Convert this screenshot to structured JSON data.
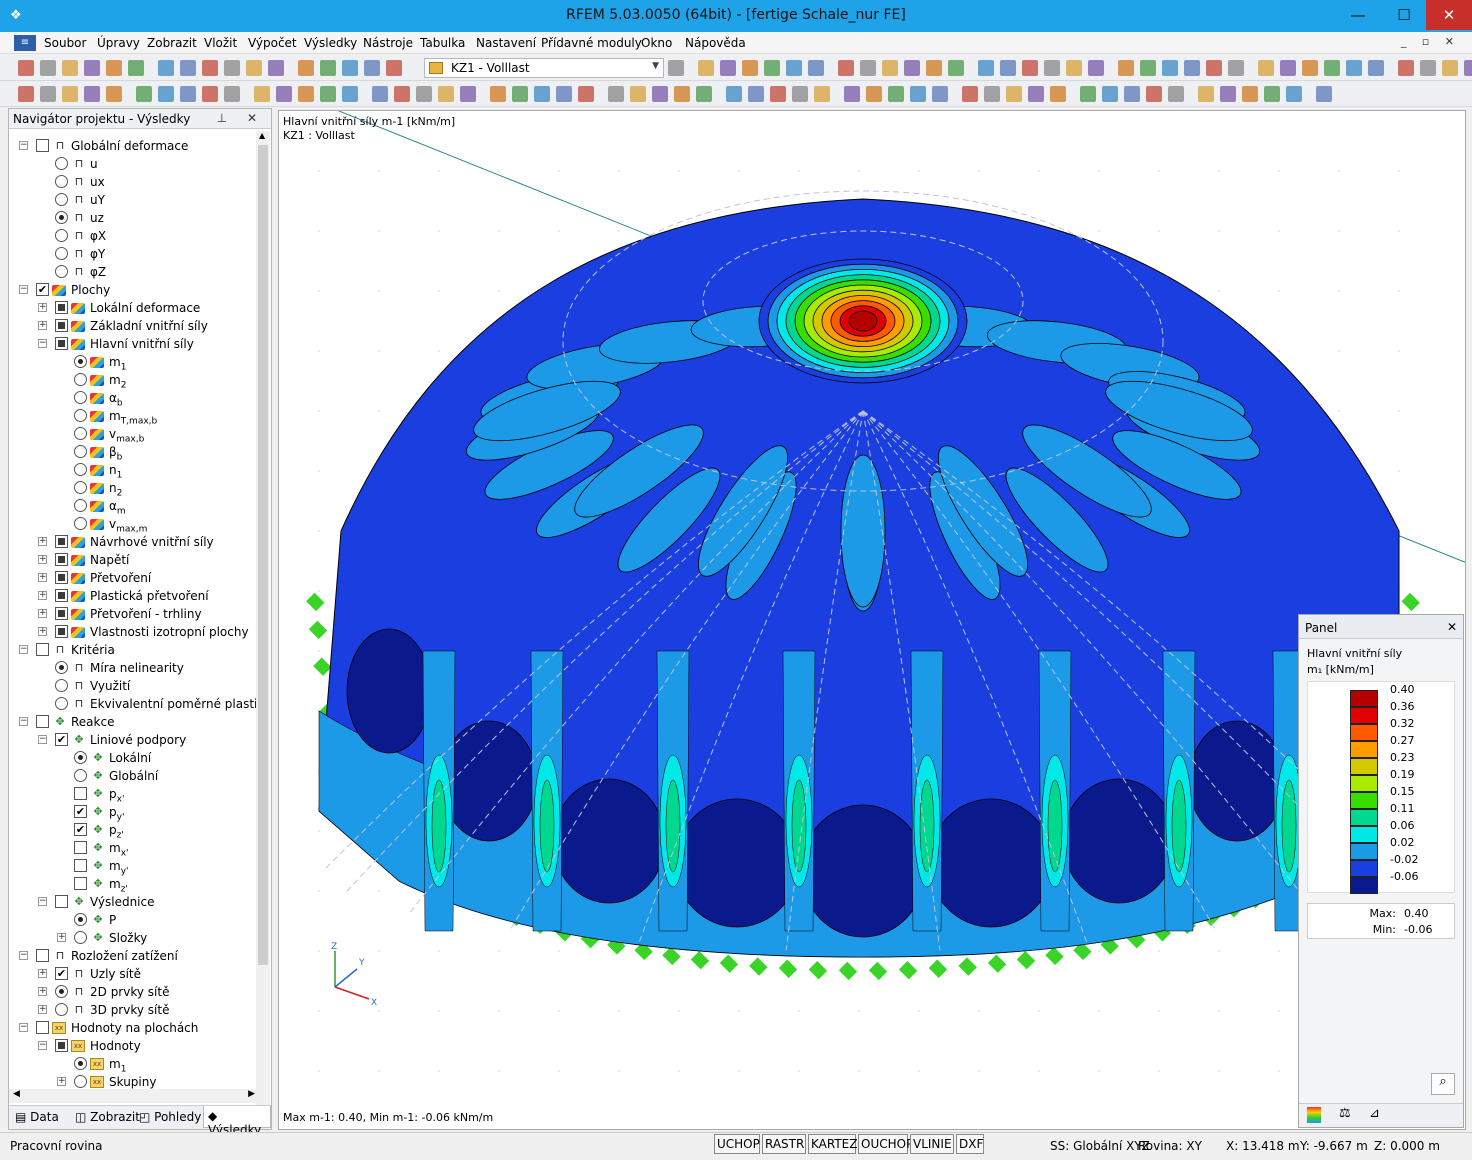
{
  "window": {
    "title": "RFEM 5.03.0050 (64bit) - [fertige Schale_nur FE]",
    "min": "—",
    "max": "☐",
    "close": "✕"
  },
  "menu": [
    "Soubor",
    "Úpravy",
    "Zobrazit",
    "Vložit",
    "Výpočet",
    "Výsledky",
    "Nástroje",
    "Tabulka",
    "Nastavení",
    "Přídavné moduly",
    "Okno",
    "Nápověda"
  ],
  "loadcase": "KZ1 - Volllast",
  "navigator": {
    "title": "Navigátor projektu - Výsledky",
    "pin": "⊥ ✕",
    "items": [
      {
        "label": "Globální deformace",
        "sub": ""
      },
      {
        "label": "u",
        "sub": ""
      },
      {
        "label": "ux",
        "sub": ""
      },
      {
        "label": "uY",
        "sub": ""
      },
      {
        "label": "uz",
        "sub": ""
      },
      {
        "label": "φX",
        "sub": ""
      },
      {
        "label": "φY",
        "sub": ""
      },
      {
        "label": "φZ",
        "sub": ""
      },
      {
        "label": "Plochy",
        "sub": ""
      },
      {
        "label": "Lokální deformace",
        "sub": ""
      },
      {
        "label": "Základní vnitřní síly",
        "sub": ""
      },
      {
        "label": "Hlavní vnitřní síly",
        "sub": ""
      },
      {
        "label": "m",
        "sub": "1"
      },
      {
        "label": "m",
        "sub": "2"
      },
      {
        "label": "α",
        "sub": "b"
      },
      {
        "label": "m",
        "sub": "T,max,b"
      },
      {
        "label": "v",
        "sub": "max,b"
      },
      {
        "label": "β",
        "sub": "b"
      },
      {
        "label": "n",
        "sub": "1"
      },
      {
        "label": "n",
        "sub": "2"
      },
      {
        "label": "α",
        "sub": "m"
      },
      {
        "label": "v",
        "sub": "max,m"
      },
      {
        "label": "Návrhové vnitřní síly",
        "sub": ""
      },
      {
        "label": "Napětí",
        "sub": ""
      },
      {
        "label": "Přetvoření",
        "sub": ""
      },
      {
        "label": "Plastická přetvoření",
        "sub": ""
      },
      {
        "label": "Přetvoření - trhliny",
        "sub": ""
      },
      {
        "label": "Vlastnosti izotropní plochy",
        "sub": ""
      },
      {
        "label": "Kritéria",
        "sub": ""
      },
      {
        "label": "Míra nelinearity",
        "sub": ""
      },
      {
        "label": "Využití",
        "sub": ""
      },
      {
        "label": "Ekvivalentní poměrné plastické",
        "sub": ""
      },
      {
        "label": "Reakce",
        "sub": ""
      },
      {
        "label": "Liniové podpory",
        "sub": ""
      },
      {
        "label": "Lokální",
        "sub": ""
      },
      {
        "label": "Globální",
        "sub": ""
      },
      {
        "label": "p",
        "sub": "x'"
      },
      {
        "label": "p",
        "sub": "y'"
      },
      {
        "label": "p",
        "sub": "z'"
      },
      {
        "label": "m",
        "sub": "x'"
      },
      {
        "label": "m",
        "sub": "y'"
      },
      {
        "label": "m",
        "sub": "z'"
      },
      {
        "label": "Výslednice",
        "sub": ""
      },
      {
        "label": "P",
        "sub": ""
      },
      {
        "label": "Složky",
        "sub": ""
      },
      {
        "label": "Rozložení zatížení",
        "sub": ""
      },
      {
        "label": "Uzly sítě",
        "sub": ""
      },
      {
        "label": "2D prvky sítě",
        "sub": ""
      },
      {
        "label": "3D prvky sítě",
        "sub": ""
      },
      {
        "label": "Hodnoty na plochách",
        "sub": ""
      },
      {
        "label": "Hodnoty",
        "sub": ""
      },
      {
        "label": "m",
        "sub": "1"
      },
      {
        "label": "Skupiny",
        "sub": ""
      }
    ],
    "tabs": [
      "Data",
      "Zobrazit",
      "Pohledy",
      "Výsledky"
    ]
  },
  "view": {
    "info1": "Hlavní vnitřní síly m-1 [kNm/m]",
    "info2": "KZ1 : Volllast",
    "bottom": "Max m-1: 0.40, Min m-1: -0.06 kNm/m",
    "axes": {
      "x": "X",
      "y": "Y",
      "z": "Z"
    }
  },
  "panel": {
    "title": "Panel",
    "close": "✕",
    "result": "Hlavní vnitřní síly",
    "unit": "m₁ [kNm/m]",
    "legend": [
      {
        "value": "0.40",
        "color": "#b40000"
      },
      {
        "value": "0.36",
        "color": "#e00000"
      },
      {
        "value": "0.32",
        "color": "#ff5a00"
      },
      {
        "value": "0.27",
        "color": "#ff9c00"
      },
      {
        "value": "0.23",
        "color": "#d4c800"
      },
      {
        "value": "0.19",
        "color": "#a8ea00"
      },
      {
        "value": "0.15",
        "color": "#38de00"
      },
      {
        "value": "0.11",
        "color": "#00d890"
      },
      {
        "value": "0.06",
        "color": "#00e8e8"
      },
      {
        "value": "0.02",
        "color": "#1c9ae8"
      },
      {
        "value": "-0.02",
        "color": "#1a3ee0"
      },
      {
        "value": "-0.06",
        "color": "#0a1a8c"
      }
    ],
    "max_label": "Max:",
    "max_value": "0.40",
    "min_label": "Min:",
    "min_value": "-0.06"
  },
  "status": {
    "left": "Pracovní rovina",
    "buttons": [
      "UCHOP",
      "RASTR",
      "KARTEZ",
      "OUCHOP",
      "VLINIE",
      "DXF"
    ],
    "ss": "SS: Globální XYZ",
    "plane": "Rovina: XY",
    "x": "X:  13.418 m",
    "y": "Y:  -9.667 m",
    "z": "Z:  0.000 m"
  },
  "colors": {
    "titlebar": "#1fa3e8",
    "dome_base": "#1a3ee0",
    "dome_light": "#1c9ae8",
    "dome_dark": "#0a1a8c",
    "support": "#3ad428"
  }
}
